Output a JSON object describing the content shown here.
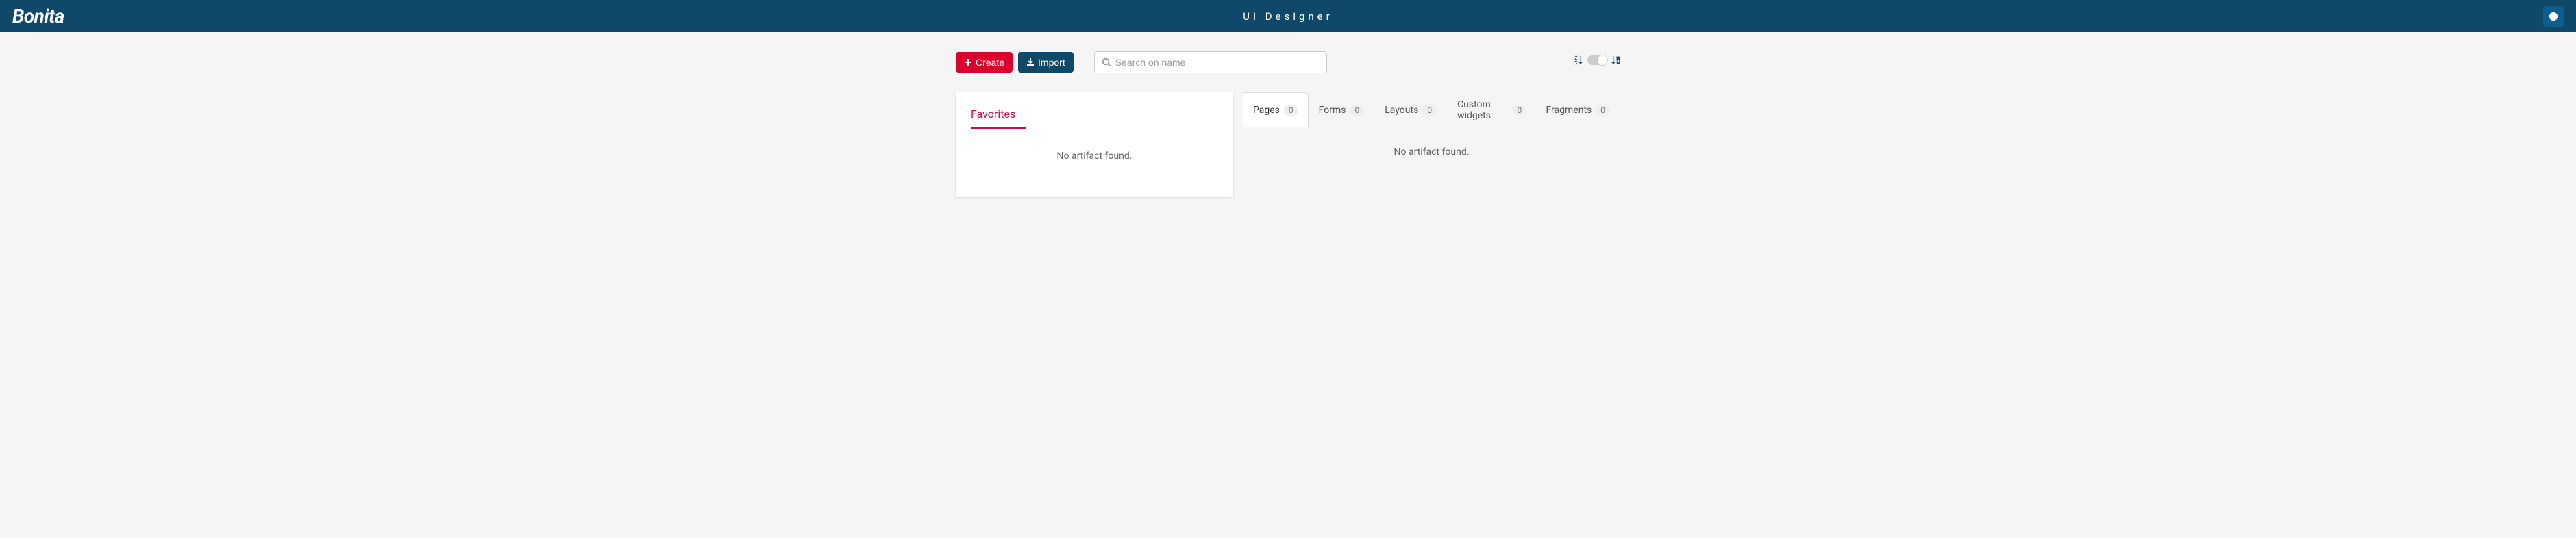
{
  "header": {
    "logo": "Bonita",
    "title": "UI Designer"
  },
  "toolbar": {
    "create_label": "Create",
    "import_label": "Import"
  },
  "search": {
    "placeholder": "Search on name"
  },
  "favorites": {
    "title": "Favorites",
    "empty_message": "No artifact found."
  },
  "tabs": {
    "items": [
      {
        "label": "Pages",
        "count": "0",
        "active": true
      },
      {
        "label": "Forms",
        "count": "0",
        "active": false
      },
      {
        "label": "Layouts",
        "count": "0",
        "active": false
      },
      {
        "label": "Custom widgets",
        "count": "0",
        "active": false
      },
      {
        "label": "Fragments",
        "count": "0",
        "active": false
      }
    ],
    "empty_message": "No artifact found."
  }
}
